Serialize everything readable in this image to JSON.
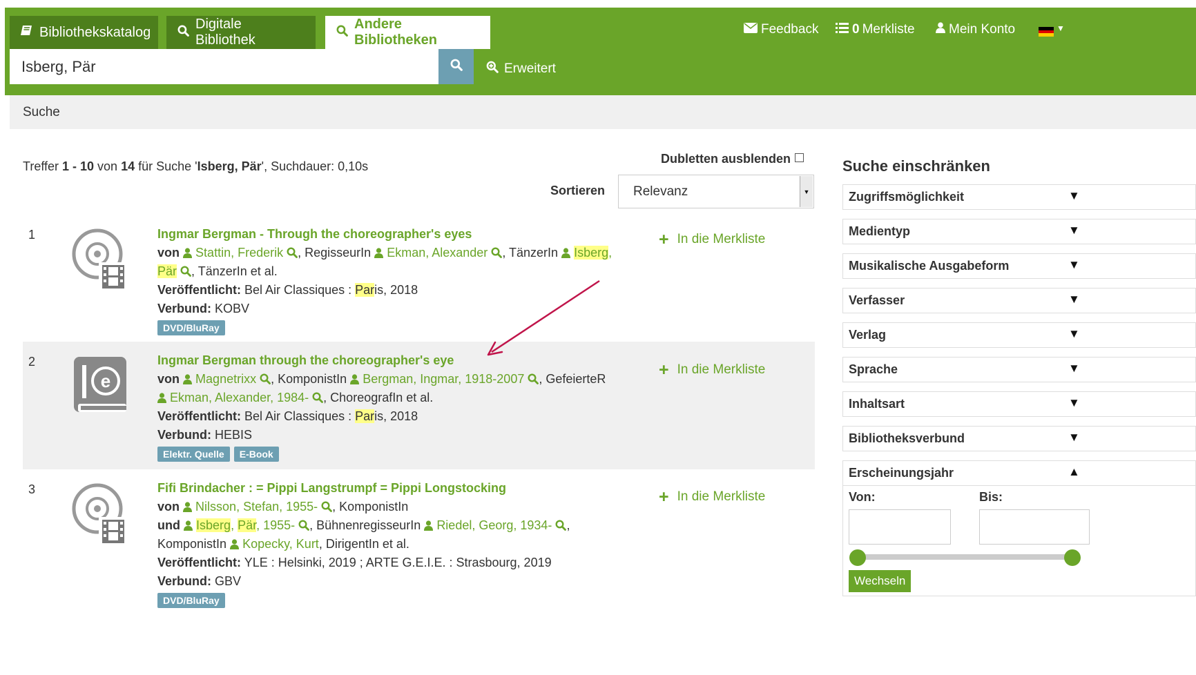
{
  "header": {
    "tabs": [
      {
        "label": "Bibliothekskatalog",
        "icon": "book-icon"
      },
      {
        "label": "Digitale Bibliothek",
        "icon": "search-icon"
      },
      {
        "label": "Andere Bibliotheken",
        "icon": "search-icon",
        "active": true
      }
    ],
    "feedback": "Feedback",
    "merkliste_count": "0",
    "merkliste": "Merkliste",
    "account": "Mein Konto",
    "language_flag": "de-flag-icon"
  },
  "search": {
    "value": "Isberg, Pär",
    "advanced": "Erweitert"
  },
  "breadcrumb": "Suche",
  "results_info": {
    "prefix": "Treffer ",
    "range": "1 - 10",
    "of": " von ",
    "total": "14",
    "for": " für Suche '",
    "query": "Isberg, Pär",
    "suffix": "', Suchdauer: 0,10s"
  },
  "dedupe_label": "Dubletten ausblenden",
  "sort": {
    "label": "Sortieren",
    "value": "Relevanz"
  },
  "merk_label": "In die Merkliste",
  "results": [
    {
      "num": "1",
      "title": "Ingmar Bergman - Through the choreographer's eyes",
      "von": "von",
      "p1": "Stattin, Frederik",
      "r1": ", RegisseurIn",
      "p2": "Ekman, Alexander",
      "r2": ", TänzerIn",
      "p3a": "Isberg",
      "p3b": ",",
      "p3c": "Pär",
      "r3": ", TänzerIn et al.",
      "pub_label": "Veröffentlicht:",
      "pub_a": "Bel Air Classiques : ",
      "pub_b": "Par",
      "pub_c": "is, 2018",
      "verbund_label": "Verbund:",
      "verbund": "KOBV",
      "badges": [
        "DVD/BluRay"
      ]
    },
    {
      "num": "2",
      "title": "Ingmar Bergman through the choreographer's eye",
      "von": "von",
      "p1": "Magnetrixx",
      "r1": ", KomponistIn",
      "p2": "Bergman, Ingmar, 1918-2007",
      "r2": ", GefeierteR",
      "p3": "Ekman, Alexander, 1984-",
      "r3": ", ChoreografIn et al.",
      "pub_label": "Veröffentlicht:",
      "pub_a": "Bel Air Classiques : ",
      "pub_b": "Par",
      "pub_c": "is, 2018",
      "verbund_label": "Verbund:",
      "verbund": "HEBIS",
      "badges": [
        "Elektr. Quelle",
        "E-Book"
      ]
    },
    {
      "num": "3",
      "title": "Fifi Brindacher : = Pippi Langstrumpf = Pippi Longstocking",
      "von": "von",
      "p1": "Nilsson, Stefan, 1955-",
      "r1": ", KomponistIn",
      "und": "und",
      "p2a": "Isberg",
      "p2b": ", ",
      "p2c": "Pär",
      "p2d": ", 1955-",
      "r2": ", BühnenregisseurIn",
      "p3": "Riedel, Georg, 1934-",
      "r3": ",",
      "r3b": "KomponistIn",
      "p4": "Kopecky, Kurt",
      "r4": ", DirigentIn et al.",
      "pub_label": "Veröffentlicht:",
      "pub": "YLE : Helsinki, 2019 ; ARTE G.E.I.E. : Strasbourg, 2019",
      "verbund_label": "Verbund:",
      "verbund": "GBV",
      "badges": [
        "DVD/BluRay"
      ]
    }
  ],
  "facets": {
    "title": "Suche einschränken",
    "items": [
      "Zugriffsmöglichkeit",
      "Medientyp",
      "Musikalische Ausgabeform",
      "Verfasser",
      "Verlag",
      "Sprache",
      "Inhaltsart",
      "Bibliotheksverbund",
      "Erscheinungsjahr"
    ],
    "year_from_label": "Von:",
    "year_to_label": "Bis:",
    "apply": "Wechseln"
  },
  "colors": {
    "brand_green": "#6aa529",
    "button_blue": "#6d9fb2",
    "highlight": "#ffff88",
    "arrow": "#c0144a"
  }
}
